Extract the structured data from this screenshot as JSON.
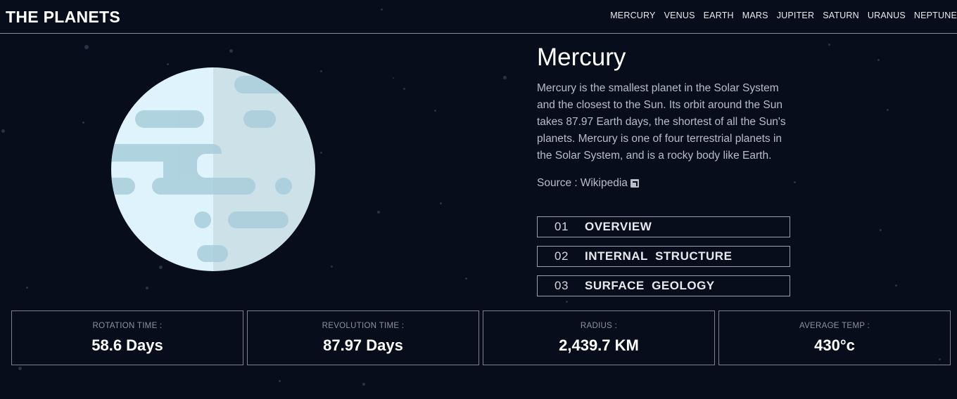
{
  "header": {
    "brand": "THE PLANETS",
    "nav": [
      "MERCURY",
      "VENUS",
      "EARTH",
      "MARS",
      "JUPITER",
      "SATURN",
      "URANUS",
      "NEPTUNE"
    ]
  },
  "planet": {
    "name": "Mercury",
    "description": "Mercury is the smallest planet in the Solar System and the closest to the Sun. Its orbit around the Sun takes 87.97 Earth days, the shortest of all the Sun's planets. Mercury is one of four terrestrial planets in the Solar System, and is a rocky body like Earth.",
    "source_prefix": "Source : ",
    "source_link": "Wikipedia"
  },
  "tabs": [
    {
      "num": "01",
      "label": "OVERVIEW"
    },
    {
      "num": "02",
      "label": "INTERNAL  STRUCTURE"
    },
    {
      "num": "03",
      "label": "SURFACE  GEOLOGY"
    }
  ],
  "stats": [
    {
      "label": "ROTATION TIME :",
      "value": "58.6 Days"
    },
    {
      "label": "REVOLUTION TIME :",
      "value": "87.97 Days"
    },
    {
      "label": "RADIUS :",
      "value": "2,439.7 KM"
    },
    {
      "label": "AVERAGE TEMP :",
      "value": "430°c"
    }
  ],
  "colors": {
    "background": "#070d1b",
    "planet_light": "#def3fb",
    "planet_dark": "#cde1e8",
    "planet_marks": "#a9cddb"
  }
}
